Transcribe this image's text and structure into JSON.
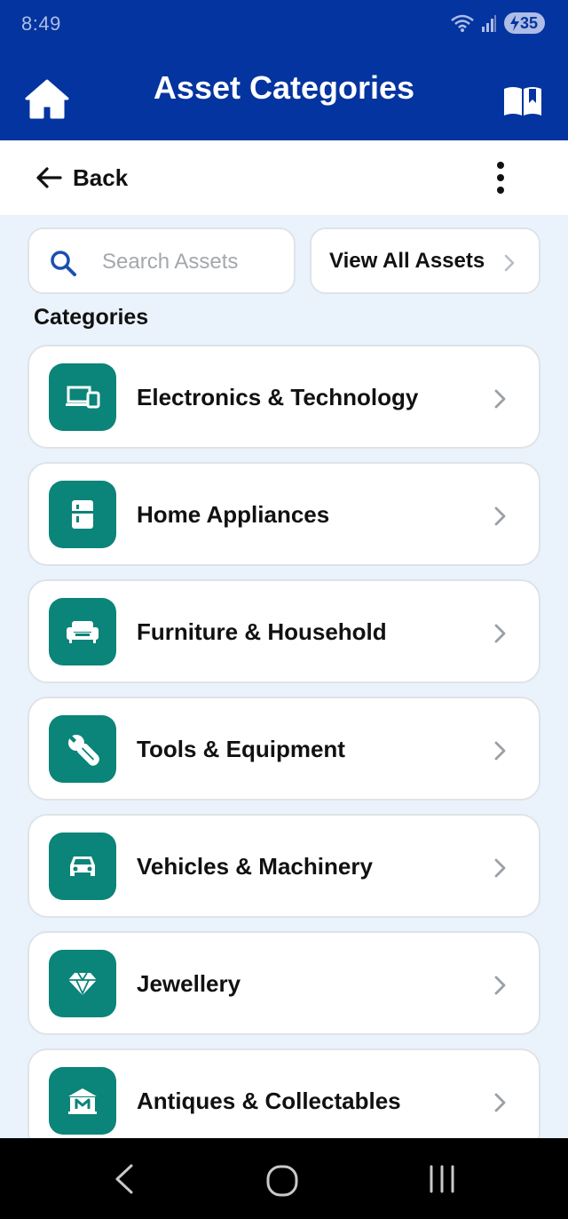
{
  "status_bar": {
    "time": "8:49",
    "battery": "35",
    "icons": [
      "wifi-icon",
      "signal-icon",
      "battery-charging-icon"
    ]
  },
  "app_bar": {
    "title": "Asset Categories",
    "left_icon": "home-icon",
    "right_icon": "book-icon"
  },
  "sub_bar": {
    "back_label": "Back",
    "more_icon": "more-vertical-icon"
  },
  "search": {
    "placeholder": "Search Assets",
    "value": ""
  },
  "view_all": {
    "label": "View All Assets"
  },
  "section_title": "Categories",
  "categories": [
    {
      "label": "Electronics & Technology",
      "icon": "devices-icon"
    },
    {
      "label": "Home Appliances",
      "icon": "fridge-icon"
    },
    {
      "label": "Furniture & Household",
      "icon": "sofa-icon"
    },
    {
      "label": "Tools & Equipment",
      "icon": "wrench-icon"
    },
    {
      "label": "Vehicles & Machinery",
      "icon": "car-icon"
    },
    {
      "label": "Jewellery",
      "icon": "diamond-icon"
    },
    {
      "label": "Antiques & Collectables",
      "icon": "museum-icon"
    }
  ],
  "colors": {
    "primary": "#04349f",
    "accent": "#0b8479",
    "background": "#eaf3fb"
  },
  "nav_bar": {
    "icons": [
      "nav-back-icon",
      "nav-home-icon",
      "nav-recents-icon"
    ]
  }
}
